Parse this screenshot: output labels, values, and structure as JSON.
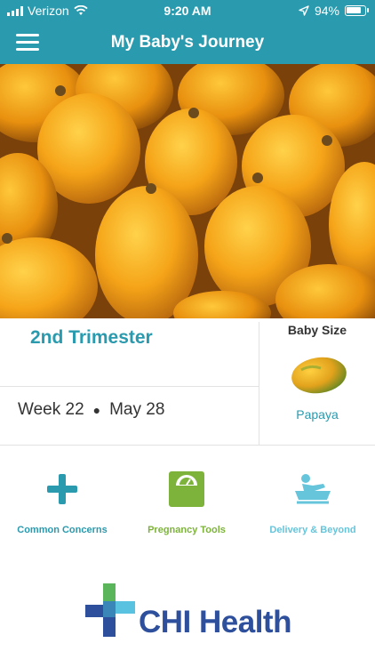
{
  "status_bar": {
    "carrier": "Verizon",
    "time": "9:20 AM",
    "battery": "94%",
    "battery_level": 0.94
  },
  "header": {
    "title": "My Baby's Journey"
  },
  "pregnancy": {
    "trimester": "2nd Trimester",
    "week": "Week 22",
    "date": "May 28",
    "baby_size_label": "Baby Size",
    "fruit": "Papaya"
  },
  "tools": [
    {
      "label": "Common Concerns",
      "icon": "plus-icon",
      "color": "#2a9aae"
    },
    {
      "label": "Pregnancy Tools",
      "icon": "scale-icon",
      "color": "#7db33b"
    },
    {
      "label": "Delivery & Beyond",
      "icon": "baby-bath-icon",
      "color": "#66c5db"
    }
  ],
  "brand": {
    "name": "CHI Health",
    "color": "#2d4f9c"
  }
}
